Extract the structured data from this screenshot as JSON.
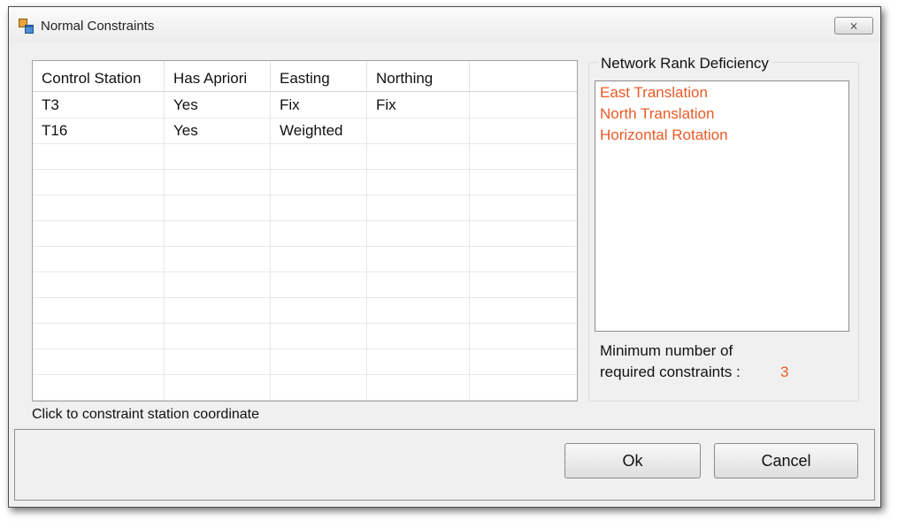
{
  "window": {
    "title": "Normal Constraints",
    "close_label": "⨯"
  },
  "grid": {
    "columns": [
      "Control Station",
      "Has Apriori",
      "Easting",
      "Northing",
      ""
    ],
    "rows": [
      [
        "T3",
        "Yes",
        "Fix",
        "Fix",
        ""
      ],
      [
        "T16",
        "Yes",
        "Weighted",
        "",
        ""
      ],
      [
        "",
        "",
        "",
        "",
        ""
      ],
      [
        "",
        "",
        "",
        "",
        ""
      ],
      [
        "",
        "",
        "",
        "",
        ""
      ],
      [
        "",
        "",
        "",
        "",
        ""
      ],
      [
        "",
        "",
        "",
        "",
        ""
      ],
      [
        "",
        "",
        "",
        "",
        ""
      ],
      [
        "",
        "",
        "",
        "",
        ""
      ],
      [
        "",
        "",
        "",
        "",
        ""
      ],
      [
        "",
        "",
        "",
        "",
        ""
      ],
      [
        "",
        "",
        "",
        "",
        ""
      ]
    ]
  },
  "status_text": "Click to constraint station coordinate",
  "rank_deficiency": {
    "group_title": "Network Rank Deficiency",
    "items": [
      "East Translation",
      "North Translation",
      "Horizontal Rotation"
    ],
    "min_label_line1": "Minimum number of",
    "min_label_line2": "required constraints :",
    "min_value": "3",
    "accent_color": "#e85a27"
  },
  "buttons": {
    "ok": "Ok",
    "cancel": "Cancel"
  }
}
